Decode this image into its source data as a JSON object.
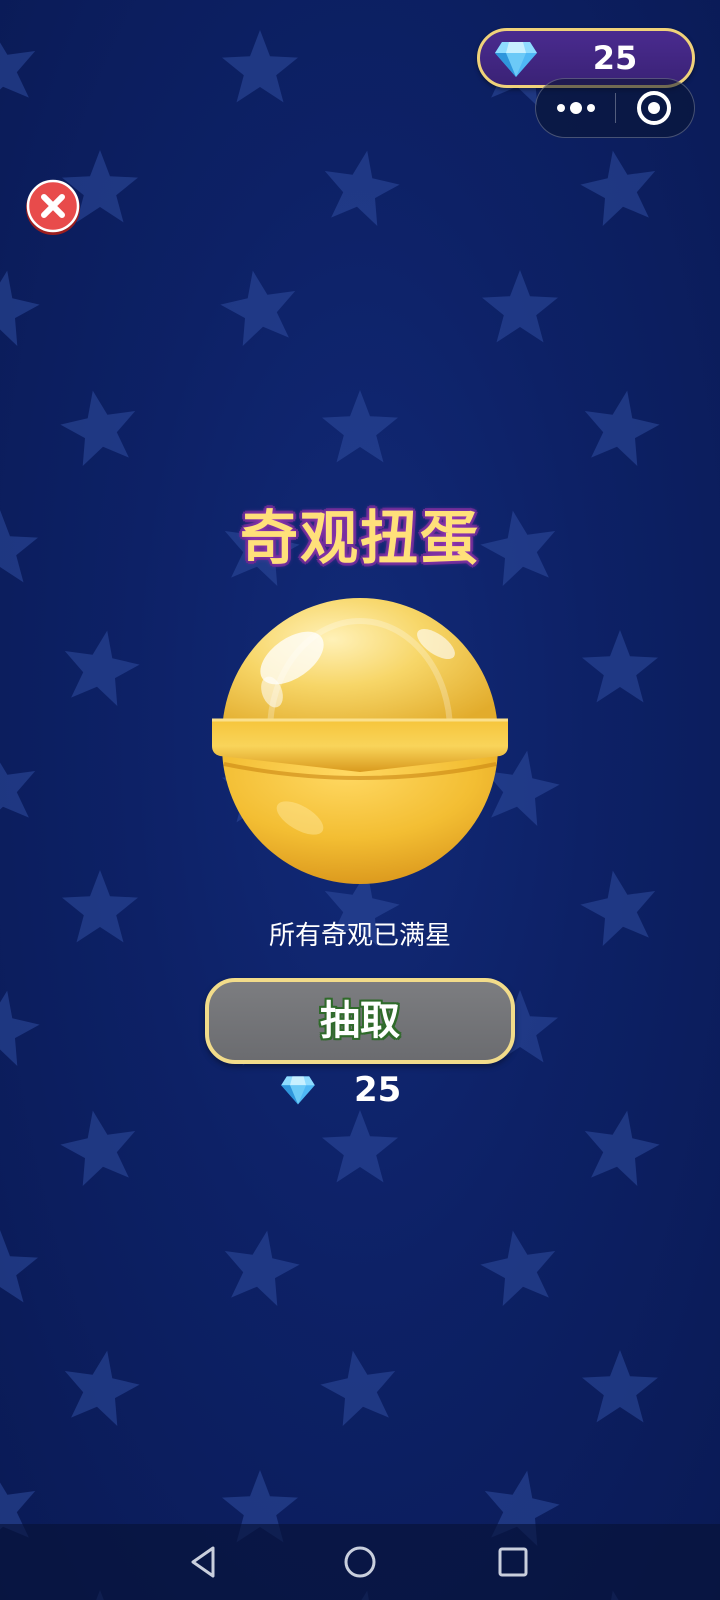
{
  "header": {
    "gem_balance": "25",
    "gem_icon": "diamond-icon",
    "menu_icons": [
      "more-dots-icon",
      "close-target-icon"
    ]
  },
  "close_icon": "close-icon",
  "title": "奇观扭蛋",
  "capsule_icon": "golden-capsule-icon",
  "status_text": "所有奇观已满星",
  "draw_button": {
    "label": "抽取",
    "enabled": false
  },
  "cost": {
    "amount": "25",
    "icon": "diamond-icon"
  },
  "nav_bar": {
    "buttons": [
      "back-icon",
      "home-icon",
      "recents-icon"
    ]
  },
  "colors": {
    "background": "#0d2166",
    "title": "#ffe07a",
    "button_disabled": "#75767a",
    "button_border": "#f2dc8a",
    "capsule_gold": "#f6c84a"
  }
}
